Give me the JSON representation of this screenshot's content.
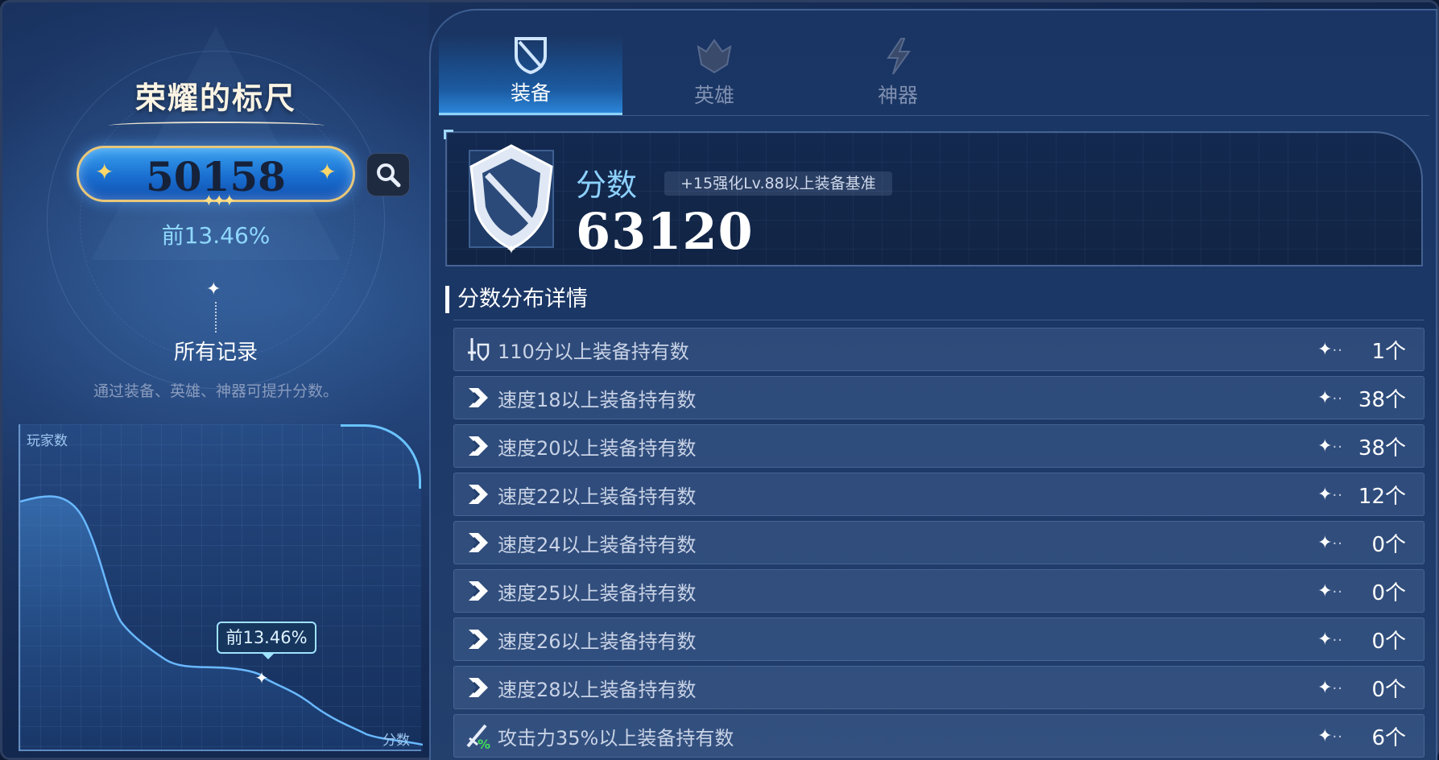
{
  "left": {
    "title": "荣耀的标尺",
    "score": "50158",
    "rank": "前13.46%",
    "all_records": "所有记录",
    "hint": "通过装备、英雄、神器可提升分数。",
    "graph": {
      "ylabel": "玩家数",
      "xlabel": "分数",
      "tooltip": "前13.46%"
    }
  },
  "tabs": [
    {
      "label": "装备",
      "icon": "equipment-shield-icon",
      "active": true
    },
    {
      "label": "英雄",
      "icon": "hero-helmet-icon",
      "active": false
    },
    {
      "label": "神器",
      "icon": "artifact-lightning-icon",
      "active": false
    }
  ],
  "score_card": {
    "label": "分数",
    "tag": "+15强化Lv.88以上装备基准",
    "value": "63120"
  },
  "section_title": "分数分布详情",
  "rows": [
    {
      "icon": "sword-shield-icon",
      "label": "110分以上装备持有数",
      "count": "1个"
    },
    {
      "icon": "speed-arrow-icon",
      "label": "速度18以上装备持有数",
      "count": "38个"
    },
    {
      "icon": "speed-arrow-icon",
      "label": "速度20以上装备持有数",
      "count": "38个"
    },
    {
      "icon": "speed-arrow-icon",
      "label": "速度22以上装备持有数",
      "count": "12个"
    },
    {
      "icon": "speed-arrow-icon",
      "label": "速度24以上装备持有数",
      "count": "0个"
    },
    {
      "icon": "speed-arrow-icon",
      "label": "速度25以上装备持有数",
      "count": "0个"
    },
    {
      "icon": "speed-arrow-icon",
      "label": "速度26以上装备持有数",
      "count": "0个"
    },
    {
      "icon": "speed-arrow-icon",
      "label": "速度28以上装备持有数",
      "count": "0个"
    },
    {
      "icon": "attack-percent-icon",
      "label": "攻击力35%以上装备持有数",
      "count": "6个"
    }
  ],
  "colors": {
    "accent": "#8cd1ff",
    "score_pill": "#1a6fd0",
    "pill_border": "#e8c77a",
    "attack_green": "#3fe05a"
  }
}
